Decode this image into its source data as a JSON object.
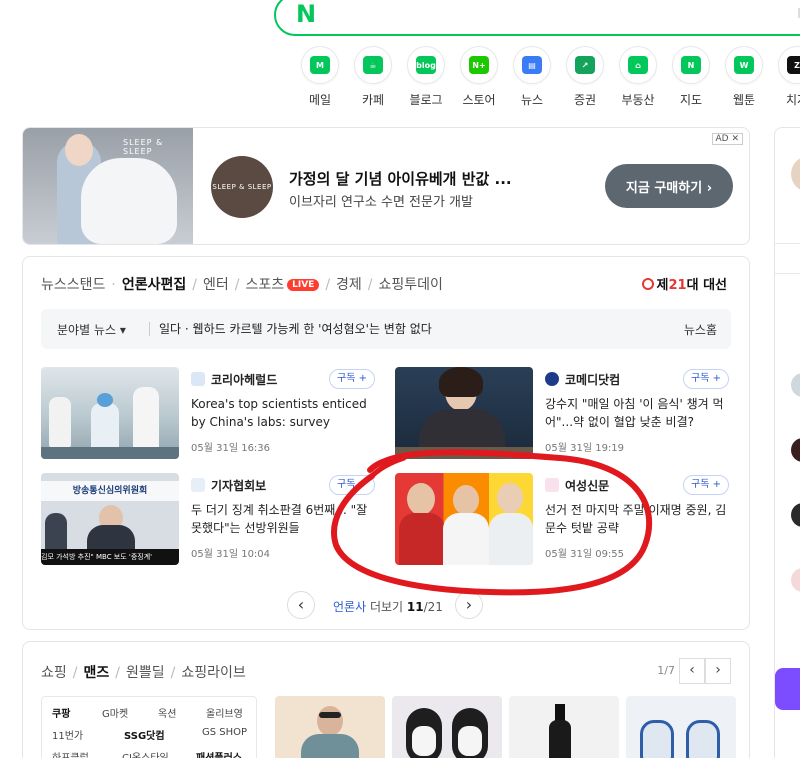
{
  "search": {
    "logo": "N"
  },
  "services": [
    {
      "label": "메일",
      "icon": "mail-icon",
      "glyph": "M"
    },
    {
      "label": "카페",
      "icon": "cafe-icon",
      "glyph": "☕"
    },
    {
      "label": "블로그",
      "icon": "blog-icon",
      "glyph": "blog"
    },
    {
      "label": "스토어",
      "icon": "store-icon",
      "glyph": "N+"
    },
    {
      "label": "뉴스",
      "icon": "news-icon",
      "glyph": "▤"
    },
    {
      "label": "증권",
      "icon": "stock-icon",
      "glyph": "↗"
    },
    {
      "label": "부동산",
      "icon": "realestate-icon",
      "glyph": "⌂"
    },
    {
      "label": "지도",
      "icon": "map-icon",
      "glyph": "N"
    },
    {
      "label": "웹툰",
      "icon": "webtoon-icon",
      "glyph": "W"
    },
    {
      "label": "치지",
      "icon": "chzzk-icon",
      "glyph": "Z"
    }
  ],
  "ad": {
    "brand": "SLEEP & SLEEP",
    "title": "가정의 달 기념 아이유베개 반값 ...",
    "subtitle": "이브자리 연구소 수면 전문가 개발",
    "cta": "지금 구매하기 ›",
    "tag": "AD ✕"
  },
  "news": {
    "tabs": [
      "뉴스스탠드",
      "언론사편집",
      "엔터",
      "스포츠",
      "경제",
      "쇼핑투데이"
    ],
    "live_badge": "LIVE",
    "election": {
      "prefix": "제",
      "number": "21",
      "suffix": "대 대선"
    },
    "ticker": {
      "category": "분야별 뉴스 ▾",
      "headline": "일다 · 웹하드 카르텔 가능케 한 '여성혐오'는 변함 없다",
      "home": "뉴스홈"
    },
    "cards": [
      {
        "press": "코리아헤럴드",
        "subscribe": "구독 +",
        "headline": "Korea's top scientists enticed by China's labs: survey",
        "time": "05월 31일 16:36"
      },
      {
        "press": "코메디닷컴",
        "subscribe": "구독 +",
        "headline": "강수지 \"매일 아침 '이 음식' 챙겨 먹어\"...약 없이 혈압 낮춘 비결?",
        "time": "05월 31일 19:19"
      },
      {
        "press": "기자협회보",
        "subscribe": "구독 +",
        "headline": "두 더기 징계 취소판결 6번째... \"잘못했다\"는 선방위원들",
        "time": "05월 31일 10:04"
      },
      {
        "press": "여성신문",
        "subscribe": "구독 +",
        "headline": "선거 전 마지막 주말 이재명 중원, 김문수 텃밭 공략",
        "time": "05월 31일 09:55"
      }
    ],
    "thumb3_banner": "방송통신심의위원회",
    "thumb3_caption": "김모 가석방 추진\" MBC 보도 '중징계'",
    "pager": {
      "prefix": "언론사",
      "middle": " 더보기 ",
      "page": "11",
      "total": "/21"
    }
  },
  "shopping": {
    "tabs": [
      "쇼핑",
      "맨즈",
      "원쁠딜",
      "쇼핑라이브"
    ],
    "page": "1/7",
    "brands": [
      "쿠팡",
      "G마켓",
      "옥션",
      "올리브영",
      "11번가",
      "SSG닷컴",
      "GS SHOP",
      "하프클럽",
      "CJ온스타일",
      "패션플러스"
    ]
  },
  "colors": {
    "accent": "#03c75a",
    "live": "#ff3c2e",
    "link": "#2c5bd4",
    "annotation": "#e0191f"
  }
}
